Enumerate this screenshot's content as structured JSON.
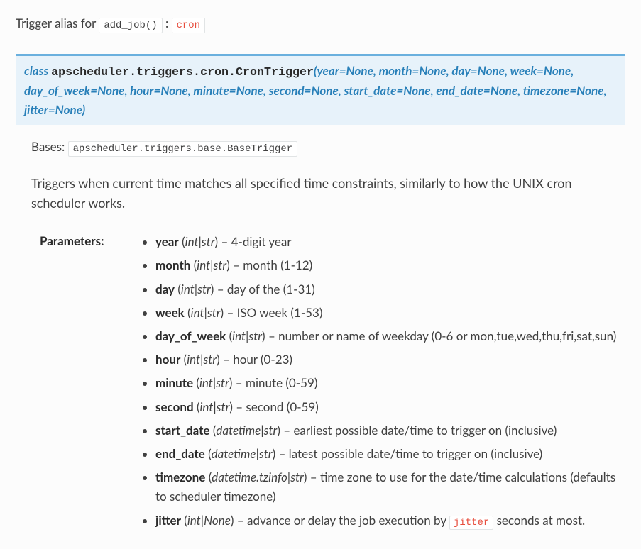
{
  "trigger": {
    "prefix": "Trigger alias for ",
    "func": "add_job()",
    "sep": ": ",
    "alias": "cron"
  },
  "signature": {
    "kw": "class ",
    "path": "apscheduler.triggers.cron.",
    "name": "CronTrigger",
    "args": "(year=None, month=None, day=None, week=None, day_of_week=None, hour=None, minute=None, second=None, start_date=None, end_date=None, timezone=None, jitter=None)"
  },
  "bases": {
    "label": "Bases: ",
    "value": "apscheduler.triggers.base.BaseTrigger"
  },
  "description": "Triggers when current time matches all specified time constraints, similarly to how the UNIX cron scheduler works.",
  "params_label": "Parameters:",
  "params": [
    {
      "name": "year",
      "type": "int|str",
      "desc": " – 4-digit year"
    },
    {
      "name": "month",
      "type": "int|str",
      "desc": " – month (1-12)"
    },
    {
      "name": "day",
      "type": "int|str",
      "desc": " – day of the (1-31)"
    },
    {
      "name": "week",
      "type": "int|str",
      "desc": " – ISO week (1-53)"
    },
    {
      "name": "day_of_week",
      "type": "int|str",
      "desc": " – number or name of weekday (0-6 or mon,tue,wed,thu,fri,sat,sun)"
    },
    {
      "name": "hour",
      "type": "int|str",
      "desc": " – hour (0-23)"
    },
    {
      "name": "minute",
      "type": "int|str",
      "desc": " – minute (0-59)"
    },
    {
      "name": "second",
      "type": "int|str",
      "desc": " – second (0-59)"
    },
    {
      "name": "start_date",
      "type": "datetime|str",
      "desc": " – earliest possible date/time to trigger on (inclusive)"
    },
    {
      "name": "end_date",
      "type": "datetime|str",
      "desc": " – latest possible date/time to trigger on (inclusive)"
    },
    {
      "name": "timezone",
      "type": "datetime.tzinfo|str",
      "desc": " – time zone to use for the date/time calculations (defaults to scheduler timezone)"
    },
    {
      "name": "jitter",
      "type": "int|None",
      "desc_pre": " – advance or delay the job execution by ",
      "code": "jitter",
      "desc_post": " seconds at most."
    }
  ]
}
